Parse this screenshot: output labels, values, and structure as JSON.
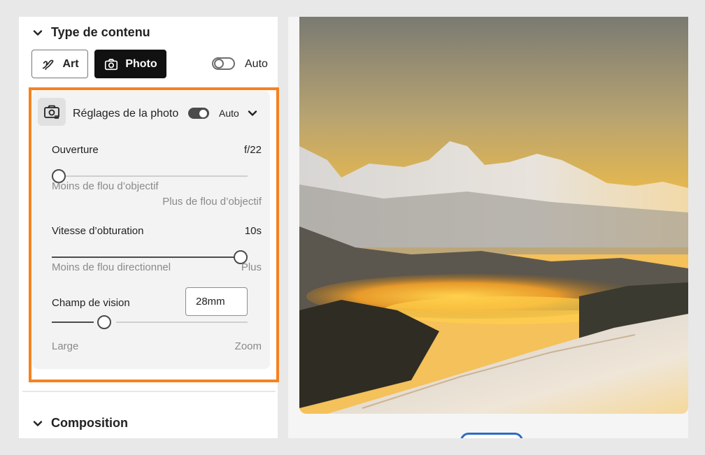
{
  "content_type": {
    "title": "Type de contenu",
    "art_label": "Art",
    "photo_label": "Photo",
    "auto_label": "Auto",
    "auto_enabled": false,
    "selected": "Photo"
  },
  "photo_settings": {
    "title": "Réglages de la photo",
    "auto_label": "Auto",
    "auto_enabled": true,
    "aperture": {
      "label": "Ouverture",
      "value": "f/22",
      "level": 0.0,
      "min_label": "Moins de flou d’objectif",
      "max_label": "Plus de flou d’objectif"
    },
    "shutter": {
      "label": "Vitesse d’obturation",
      "value": "10s",
      "level": 1.0,
      "min_label": "Moins de flou directionnel",
      "max_label": "Plus"
    },
    "fov": {
      "label": "Champ de vision",
      "value": "28mm",
      "level": 0.27,
      "min_label": "Large",
      "max_label": "Zoom"
    }
  },
  "composition": {
    "title": "Composition"
  },
  "colors": {
    "highlight": "#f58220",
    "dark": "#111111",
    "accent_blue": "#2d6cc5"
  },
  "icons": [
    "chevron-down-icon",
    "brush-icon",
    "camera-icon",
    "camera-settings-icon"
  ]
}
